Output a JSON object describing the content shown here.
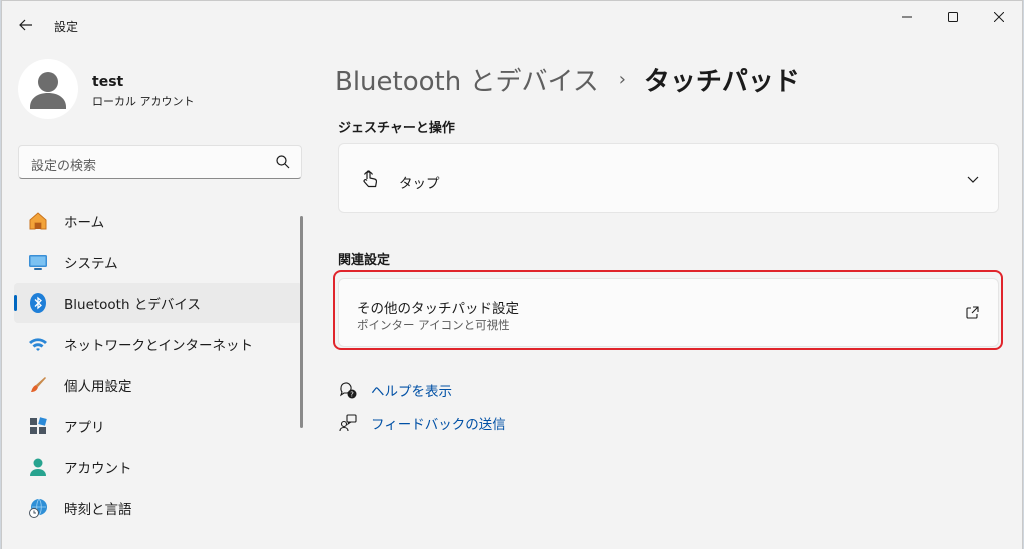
{
  "window": {
    "title": "設定"
  },
  "profile": {
    "name": "test",
    "account_type": "ローカル アカウント"
  },
  "search": {
    "placeholder": "設定の検索"
  },
  "sidebar": {
    "items": [
      {
        "label": "ホーム",
        "icon": "home-icon"
      },
      {
        "label": "システム",
        "icon": "system-icon"
      },
      {
        "label": "Bluetooth とデバイス",
        "icon": "bluetooth-icon",
        "active": true
      },
      {
        "label": "ネットワークとインターネット",
        "icon": "wifi-icon"
      },
      {
        "label": "個人用設定",
        "icon": "paintbrush-icon"
      },
      {
        "label": "アプリ",
        "icon": "apps-icon"
      },
      {
        "label": "アカウント",
        "icon": "account-icon"
      },
      {
        "label": "時刻と言語",
        "icon": "globe-clock-icon"
      }
    ]
  },
  "breadcrumb": {
    "parent": "Bluetooth とデバイス",
    "separator": "›",
    "current": "タッチパッド"
  },
  "gestures": {
    "heading": "ジェスチャーと操作",
    "tap_label": "タップ"
  },
  "related": {
    "heading": "関連設定",
    "title": "その他のタッチパッド設定",
    "subtitle": "ポインター アイコンと可視性"
  },
  "links": {
    "help": "ヘルプを表示",
    "feedback": "フィードバックの送信"
  },
  "colors": {
    "accent": "#0067c0",
    "highlight": "#e0242b",
    "link": "#0050a5"
  }
}
